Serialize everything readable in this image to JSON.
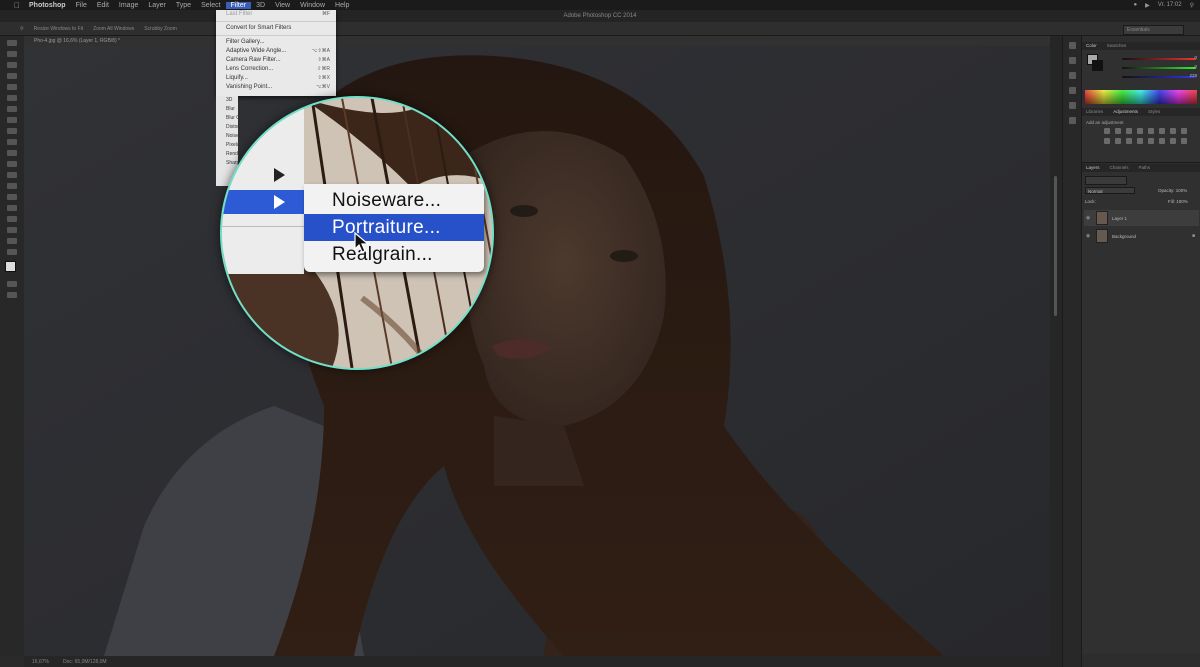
{
  "menubar": {
    "apple": "",
    "app": "Photoshop",
    "items": [
      "File",
      "Edit",
      "Image",
      "Layer",
      "Type",
      "Select",
      "Filter",
      "3D",
      "View",
      "Window",
      "Help"
    ],
    "active_index": 6,
    "clock": "Vr. 17:02"
  },
  "title": {
    "text": "Adobe Photoshop CC 2014"
  },
  "options_bar": {
    "items": [
      "Resize Windows to Fit",
      "Zoom All Windows",
      "Scrubby Zoom"
    ],
    "workspace": "Essentials"
  },
  "document": {
    "tab": "Pho-4.jpg @ 16,6% (Layer 1, RGB/8) *",
    "zoom": "16,67%",
    "doc_size": "Doc: 65,0M/128,0M"
  },
  "filter_menu": {
    "items": [
      {
        "label": "Last Filter",
        "shortcut": "⌘F",
        "enabled": false
      },
      {
        "separator": true
      },
      {
        "label": "Convert for Smart Filters",
        "shortcut": "",
        "enabled": true
      },
      {
        "separator": true
      },
      {
        "label": "Filter Gallery...",
        "shortcut": "",
        "enabled": true
      },
      {
        "label": "Adaptive Wide Angle...",
        "shortcut": "⌥⇧⌘A",
        "enabled": true
      },
      {
        "label": "Camera Raw Filter...",
        "shortcut": "⇧⌘A",
        "enabled": true
      },
      {
        "label": "Lens Correction...",
        "shortcut": "⇧⌘R",
        "enabled": true
      },
      {
        "label": "Liquify...",
        "shortcut": "⇧⌘X",
        "enabled": true
      },
      {
        "label": "Vanishing Point...",
        "shortcut": "⌥⌘V",
        "enabled": true
      }
    ],
    "submenus": [
      "3D",
      "Blur",
      "Blur Gallery",
      "Distort",
      "Noise",
      "Pixelate",
      "Render",
      "Sharpen"
    ]
  },
  "magnifier": {
    "submenu_items": [
      "Noiseware...",
      "Portraiture...",
      "Realgrain..."
    ],
    "highlighted_index": 1
  },
  "panels": {
    "color_tabs": [
      "Color",
      "Swatches"
    ],
    "color_values": [
      "0",
      "0",
      "229"
    ],
    "adjust_tabs": [
      "Libraries",
      "Adjustments",
      "Styles"
    ],
    "adjust_label": "Add an adjustment",
    "layers_tabs": [
      "Layers",
      "Channels",
      "Paths"
    ],
    "blend_mode": "Normal",
    "opacity_label": "Opacity: 100%",
    "lock_label": "Lock:",
    "fill_label": "Fill: 100%",
    "layers": [
      {
        "name": "Layer 1",
        "selected": true
      },
      {
        "name": "Background",
        "selected": false
      }
    ]
  },
  "colors": {
    "accent_blue": "#2751c9",
    "magnifier_ring": "#6ee0c8"
  }
}
